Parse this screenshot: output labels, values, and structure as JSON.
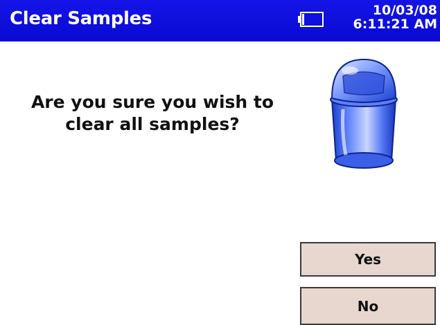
{
  "title_bar": {
    "title": "Clear Samples",
    "date": "10/03/08",
    "time": "6:11:21 AM",
    "battery_icon": "battery-empty-icon",
    "background_color": "#0e0ee0"
  },
  "dialog": {
    "question_line1": "Are you sure you wish to",
    "question_line2": "clear all samples?",
    "icon": "trash-can-icon"
  },
  "buttons": {
    "yes_label": "Yes",
    "no_label": "No",
    "button_color": "#e7d7cf"
  }
}
